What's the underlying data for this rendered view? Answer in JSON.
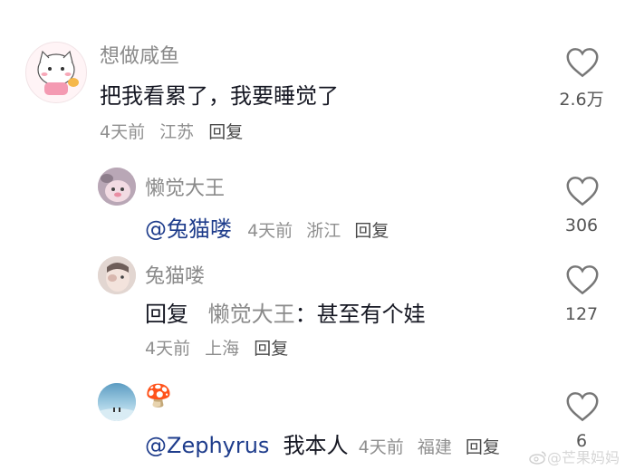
{
  "comments": [
    {
      "username": "想做咸鱼",
      "text": "把我看累了，我要睡觉了",
      "time": "4天前",
      "location": "江苏",
      "reply_label": "回复",
      "likes": "2.6万"
    },
    {
      "username": "懒觉大王",
      "mention": "@兔猫喽",
      "time": "4天前",
      "location": "浙江",
      "reply_label": "回复",
      "likes": "306"
    },
    {
      "username": "兔猫喽",
      "reply_prefix": "回复",
      "reply_target": "懒觉大王",
      "reply_text": "：甚至有个娃",
      "time": "4天前",
      "location": "上海",
      "reply_label": "回复",
      "likes": "127"
    },
    {
      "username_emoji": "🍄",
      "mention": "@Zephyrus",
      "text": "我本人",
      "time": "4天前",
      "location": "福建",
      "reply_label": "回复",
      "likes": "6"
    }
  ],
  "watermark": {
    "platform": "微博",
    "text": "@芒果妈妈"
  }
}
